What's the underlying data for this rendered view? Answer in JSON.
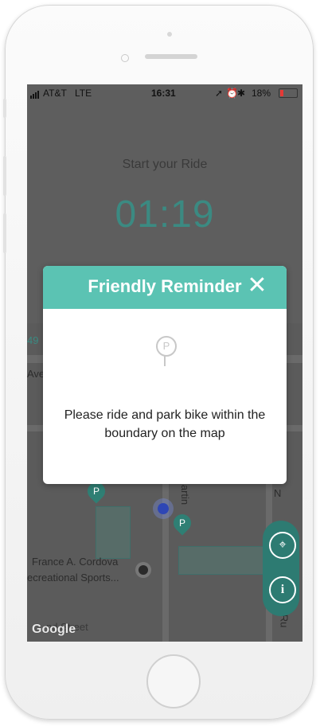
{
  "status_bar": {
    "carrier": "AT&T",
    "network": "LTE",
    "time": "16:31",
    "battery": "18%"
  },
  "ride": {
    "title": "Start your Ride",
    "timer": "01:19"
  },
  "modal": {
    "title": "Friendly Reminder",
    "close_icon": "close-icon",
    "body_icon": "parking-sign-icon",
    "message": "Please ride and park bike within the boundary on the map"
  },
  "map": {
    "partial_number": "49",
    "partial_ave": "Ave",
    "pin_label": "P",
    "poi_name_line1": "France A. Cordova",
    "poi_name_line2": "ecreational Sports...",
    "street_partial": "nd Street",
    "street_right_1": "N",
    "street_right_2": "N Ru",
    "street_side": "artin",
    "attribution": "Google"
  },
  "map_controls": {
    "locate_icon": "crosshair-icon",
    "info_icon": "info-icon"
  },
  "colors": {
    "teal": "#5bc3b3",
    "teal_dark": "#2d7b72",
    "timer": "#3b8a82"
  }
}
